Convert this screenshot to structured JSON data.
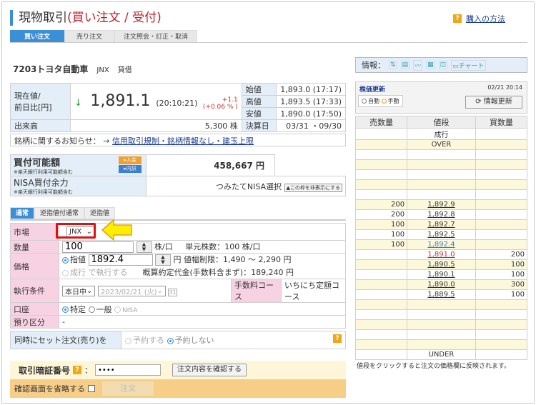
{
  "header": {
    "title": "現物取引",
    "subtitle": "(買い注文 / 受付)",
    "help_link": "購入の方法",
    "help_icon": "?"
  },
  "tabs": [
    "買い注文",
    "売り注文",
    "注文照会・訂正・取消"
  ],
  "stock": {
    "name": "7203トヨタ自動車",
    "market": "JNX",
    "type": "貸借"
  },
  "quote": {
    "price_label_1": "現在値/",
    "price_label_2": "前日比[円]",
    "direction": "↓",
    "price": "1,891.1",
    "time": "(20:10:21)",
    "change": "+1.1",
    "change_pct": "(+0.06 % )",
    "volume_label": "出来高",
    "volume": "5,300 株",
    "side": [
      {
        "label": "始値",
        "value": "1,893.0 (17:17)"
      },
      {
        "label": "高値",
        "value": "1,893.5 (17:33)"
      },
      {
        "label": "安値",
        "value": "1,890.0 (17:50)"
      },
      {
        "label": "決算日",
        "value": "03/31 ・09/30"
      }
    ]
  },
  "notice": {
    "label": "銘柄に関するお知らせ：",
    "arrow": "→",
    "link": "信用取引規制・銘柄情報なし・建玉上限"
  },
  "buying": {
    "label": "買付可能額",
    "note": "※楽天銀行利用可能額含む",
    "deposit": "▸入金",
    "detail": "▸内訳",
    "amount": "458,667 円",
    "nisa_label": "NISA買付余力",
    "nisa_note": "※楽天銀行利用可能額含む",
    "nisa_value": "つみたてNISA選択",
    "hide_btn": "▲この枠を非表示にする"
  },
  "order_tabs": [
    "通常",
    "逆指値付通常",
    "逆指値"
  ],
  "form": {
    "market_label": "市場",
    "market": "JNX",
    "qty_label": "数量",
    "qty": "100",
    "qty_unit": "株/口",
    "unit_info": "単元株数：100 株/口",
    "price_label": "価格",
    "limit": "指値",
    "price": "1892.4",
    "yen": "円",
    "limit_range": "値幅制限：1,490 ～ 2,290 円",
    "market_order": "成行 で執行する",
    "estimate": "概算約定代金(手数料含まず)：189,240 円",
    "cond_label": "執行条件",
    "cond": "本日中",
    "date": "2023/02/21 (火)",
    "cal": "31",
    "fee_label": "手数料コース",
    "fee": "いちにち定額コース",
    "account_label": "口座",
    "acc1": "特定",
    "acc2": "一般",
    "acc3": "NISA",
    "deposit_label": "預り区分",
    "deposit": "-"
  },
  "set_order": {
    "label": "同時にセット注文(売り)を",
    "opt1": "予約する",
    "opt2": "予約しない"
  },
  "pin": {
    "label": "取引暗証番号",
    "colon": "：",
    "value": "••••",
    "confirm_btn": "注文内容を確認する",
    "skip_label": "確認画面を省略する",
    "order_btn": "注文"
  },
  "info": {
    "label": "情報：",
    "icons": [
      "⇅",
      "▤",
      "〰",
      "▦",
      "◫",
      "▭チャート"
    ]
  },
  "update": {
    "label": "株価更新",
    "time": "02/21 20:14",
    "auto": "自動",
    "manual": "手動",
    "refresh": "情報更新"
  },
  "book": {
    "headers": [
      "売数量",
      "値段",
      "買数量"
    ],
    "rows": [
      [
        "",
        "成行",
        ""
      ],
      [
        "",
        "OVER",
        ""
      ],
      [
        "",
        "",
        ""
      ],
      [
        "",
        "",
        ""
      ],
      [
        "",
        "",
        ""
      ],
      [
        "",
        "",
        ""
      ],
      [
        "",
        "",
        ""
      ],
      [
        "200",
        "1,892.9",
        ""
      ],
      [
        "200",
        "1,892.8",
        ""
      ],
      [
        "100",
        "1,892.7",
        ""
      ],
      [
        "100",
        "1,892.5",
        ""
      ],
      [
        "100",
        "1,892.4",
        ""
      ],
      [
        "",
        "1,891.0",
        "200"
      ],
      [
        "",
        "1,890.5",
        "100"
      ],
      [
        "",
        "1,890.1",
        "100"
      ],
      [
        "",
        "1,890.0",
        "300"
      ],
      [
        "",
        "1,889.5",
        "100"
      ],
      [
        "",
        "",
        ""
      ],
      [
        "",
        "",
        ""
      ],
      [
        "",
        "",
        ""
      ],
      [
        "",
        "",
        ""
      ],
      [
        "",
        "",
        ""
      ],
      [
        "",
        "UNDER",
        ""
      ]
    ],
    "note": "値段をクリックすると注文の価格欄に反映されます。"
  },
  "colors": {
    "accent": "#3b8fd6",
    "title_red": "#c01f2b",
    "highlight_price": "#3b7fc0",
    "current_price": "#c03030"
  }
}
